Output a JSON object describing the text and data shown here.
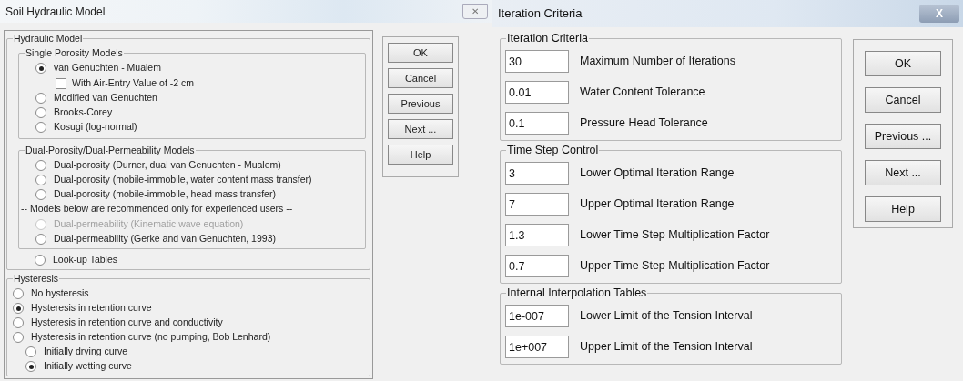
{
  "left_dialog": {
    "title": "Soil Hydraulic Model",
    "close": "✕",
    "hydraulic_model": {
      "title": "Hydraulic Model",
      "single_porosity": {
        "title": "Single Porosity Models",
        "options": [
          {
            "label": "van Genuchten - Mualem",
            "selected": true,
            "disabled": false
          },
          {
            "kind": "checkbox",
            "label": "With Air-Entry Value of -2 cm",
            "checked": false
          },
          {
            "label": "Modified van Genuchten",
            "selected": false,
            "disabled": false
          },
          {
            "label": "Brooks-Corey",
            "selected": false,
            "disabled": false
          },
          {
            "label": "Kosugi (log-normal)",
            "selected": false,
            "disabled": false
          }
        ]
      },
      "dual": {
        "title": "Dual-Porosity/Dual-Permeability Models",
        "options": [
          {
            "label": "Dual-porosity (Durner, dual van Genuchten - Mualem)",
            "selected": false,
            "disabled": false
          },
          {
            "label": "Dual-porosity (mobile-immobile, water content mass transfer)",
            "selected": false,
            "disabled": false
          },
          {
            "label": "Dual-porosity (mobile-immobile, head mass transfer)",
            "selected": false,
            "disabled": false
          },
          {
            "kind": "note",
            "label": "-- Models below are recommended only for experienced users --"
          },
          {
            "label": "Dual-permeability (Kinematic wave equation)",
            "selected": false,
            "disabled": true
          },
          {
            "label": "Dual-permeability (Gerke and van Genuchten, 1993)",
            "selected": false,
            "disabled": false
          }
        ]
      },
      "lookup": {
        "label": "Look-up Tables",
        "selected": false,
        "disabled": false
      }
    },
    "hysteresis": {
      "title": "Hysteresis",
      "options": [
        {
          "label": "No hysteresis",
          "selected": false
        },
        {
          "label": "Hysteresis in retention curve",
          "selected": true
        },
        {
          "label": "Hysteresis in retention curve and conductivity",
          "selected": false
        },
        {
          "label": "Hysteresis in retention curve (no pumping, Bob Lenhard)",
          "selected": false
        }
      ],
      "sub_options": [
        {
          "label": "Initially drying curve",
          "selected": false
        },
        {
          "label": "Initially wetting curve",
          "selected": true
        }
      ]
    },
    "buttons": [
      "OK",
      "Cancel",
      "Previous",
      "Next ...",
      "Help"
    ]
  },
  "right_dialog": {
    "title": "Iteration Criteria",
    "close": "X",
    "groups": [
      {
        "title": "Iteration Criteria",
        "fields": [
          {
            "value": "30",
            "label": "Maximum Number of Iterations"
          },
          {
            "value": "0.01",
            "label": "Water Content Tolerance"
          },
          {
            "value": "0.1",
            "label": "Pressure Head Tolerance"
          }
        ]
      },
      {
        "title": "Time Step Control",
        "fields": [
          {
            "value": "3",
            "label": "Lower Optimal Iteration Range"
          },
          {
            "value": "7",
            "label": "Upper Optimal Iteration Range"
          },
          {
            "value": "1.3",
            "label": "Lower Time Step Multiplication Factor"
          },
          {
            "value": "0.7",
            "label": "Upper Time Step Multiplication Factor"
          }
        ]
      },
      {
        "title": "Internal Interpolation Tables",
        "fields": [
          {
            "value": "1e-007",
            "label": "Lower Limit of the Tension Interval"
          },
          {
            "value": "1e+007",
            "label": "Upper Limit of the Tension Interval"
          }
        ]
      }
    ],
    "buttons": [
      "OK",
      "Cancel",
      "Previous ...",
      "Next ...",
      "Help"
    ]
  }
}
